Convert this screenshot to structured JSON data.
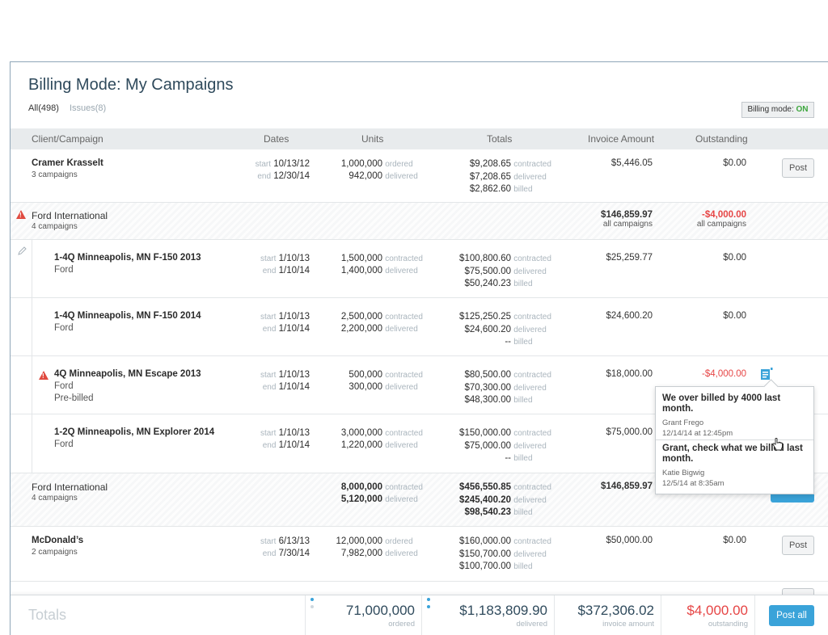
{
  "title": "Billing Mode: My Campaigns",
  "filters": {
    "all": "All(498)",
    "issues": "Issues(8)"
  },
  "billing_mode": {
    "label": "Billing mode:",
    "value": "ON"
  },
  "headers": [
    "Client/Campaign",
    "Dates",
    "Units",
    "Totals",
    "Invoice Amount",
    "Outstanding"
  ],
  "labels": {
    "start": "start",
    "end": "end",
    "ordered": "ordered",
    "delivered": "delivered",
    "contracted": "contracted",
    "billed": "billed",
    "all_campaigns": "all campaigns",
    "post": "Post"
  },
  "rows": [
    {
      "name": "Cramer Krasselt",
      "sub": "3 campaigns",
      "start": "10/13/12",
      "end": "12/30/14",
      "units": [
        "1,000,000",
        "942,000"
      ],
      "totals": [
        "$9,208.65",
        "$7,208.65",
        "$2,862.60"
      ],
      "invoice": "$5,446.05",
      "outstanding": "$0.00"
    },
    {
      "name": "Ford International",
      "sub": "4 campaigns",
      "invoice": "$146,859.97",
      "outstanding": "-$4,000.00"
    },
    {
      "name": "1-4Q Minneapolis, MN F-150 2013",
      "sub": "Ford",
      "start": "1/10/13",
      "end": "1/10/14",
      "units": [
        "1,500,000",
        "1,400,000"
      ],
      "totals": [
        "$100,800.60",
        "$75,500.00",
        "$50,240.23"
      ],
      "invoice": "$25,259.77",
      "outstanding": "$0.00"
    },
    {
      "name": "1-4Q Minneapolis, MN F-150 2014",
      "sub": "Ford",
      "start": "1/10/13",
      "end": "1/10/14",
      "units": [
        "2,500,000",
        "2,200,000"
      ],
      "totals": [
        "$125,250.25",
        "$24,600.20",
        "--"
      ],
      "invoice": "$24,600.20",
      "outstanding": "$0.00"
    },
    {
      "name": "4Q Minneapolis, MN Escape 2013",
      "sub": "Ford",
      "sub2": "Pre-billed",
      "start": "1/10/13",
      "end": "1/10/14",
      "units": [
        "500,000",
        "300,000"
      ],
      "totals": [
        "$80,500.00",
        "$70,300.00",
        "$48,300.00"
      ],
      "invoice": "$18,000.00",
      "outstanding": "-$4,000.00"
    },
    {
      "name": "1-2Q Minneapolis, MN Explorer 2014",
      "sub": "Ford",
      "start": "1/10/13",
      "end": "1/10/14",
      "units": [
        "3,000,000",
        "1,220,000"
      ],
      "totals": [
        "$150,000.00",
        "$75,000.00",
        "--"
      ],
      "invoice": "$75,000.00"
    },
    {
      "name": "Ford International",
      "sub": "4 campaigns",
      "units": [
        "8,000,000",
        "5,120,000"
      ],
      "totals": [
        "$456,550.85",
        "$245,400.20",
        "$98,540.23"
      ],
      "invoice": "$146,859.97"
    },
    {
      "name": "McDonald’s",
      "sub": "2 campaigns",
      "start": "6/13/13",
      "end": "7/30/14",
      "units": [
        "12,000,000",
        "7,982,000"
      ],
      "totals": [
        "$160,000.00",
        "$150,700.00",
        "$100,700.00"
      ],
      "invoice": "$50,000.00",
      "outstanding": "$0.00"
    }
  ],
  "notes": [
    {
      "text": "We over billed by 4000 last month.",
      "author": "Grant Frego",
      "time": "12/14/14 at 12:45pm"
    },
    {
      "text": "Grant, check what we billed last month.",
      "author": "Katie Bigwig",
      "time": "12/5/14 at 8:35am"
    }
  ],
  "footer": {
    "label": "Totals",
    "ordered": {
      "value": "71,000,000",
      "label": "ordered"
    },
    "delivered": {
      "value": "$1,183,809.90",
      "label": "delivered"
    },
    "invoice": {
      "value": "$372,306.02",
      "label": "invoice amount"
    },
    "outstanding": {
      "value": "$4,000.00",
      "label": "outstanding"
    },
    "post_all": "Post all"
  },
  "colors": {
    "accent": "#3aa3d9",
    "negative": "#e64545",
    "on": "#3ca63c"
  }
}
